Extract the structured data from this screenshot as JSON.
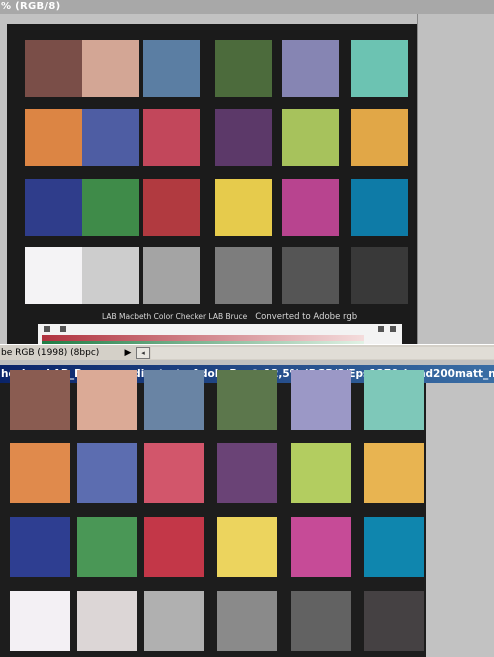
{
  "back_window": {
    "title": "% (RGB/8)",
    "caption_left": "LAB Macbeth Color Checker LAB Bruce",
    "caption_right": "Converted to Adobe rgb",
    "status_text": "be RGB (1998) (8bpc)",
    "status_arrow": "▶",
    "scroll_left_glyph": "◂",
    "swatches": [
      [
        "#7a4e48",
        "#d3a695",
        "#5b7ea3",
        "#4c6b3c",
        "#8685b3",
        "#6cc3b2"
      ],
      [
        "#dc8544",
        "#4e5da3",
        "#c2475b",
        "#5c3969",
        "#a7c25c",
        "#e1a747"
      ],
      [
        "#2f3d8b",
        "#3f8b49",
        "#b13a40",
        "#e6cb4c",
        "#b8448f",
        "#0e7ba7"
      ],
      [
        "#f4f3f5",
        "#cdcdcd",
        "#a4a4a4",
        "#7d7d7d",
        "#555555",
        "#393939"
      ]
    ]
  },
  "front_window": {
    "title": "hecker_LAB_Bruce_gradienty_to AdobeR...@ 12,5% (RGB/8/Eps1270_lomd200matt_n...",
    "swatches": [
      [
        "#8a5c51",
        "#dbaa96",
        "#6984a4",
        "#5c774c",
        "#9b98c6",
        "#7ec8b9"
      ],
      [
        "#e08a4c",
        "#5c6db0",
        "#d2566b",
        "#6a4376",
        "#b3cd60",
        "#e8b451"
      ],
      [
        "#2e3e91",
        "#4a9756",
        "#c33748",
        "#ecd45e",
        "#c64b97",
        "#0f86ae"
      ],
      [
        "#f3f0f4",
        "#dcd6d6",
        "#b0b0b0",
        "#8a8a8a",
        "#626262",
        "#454143"
      ]
    ]
  }
}
